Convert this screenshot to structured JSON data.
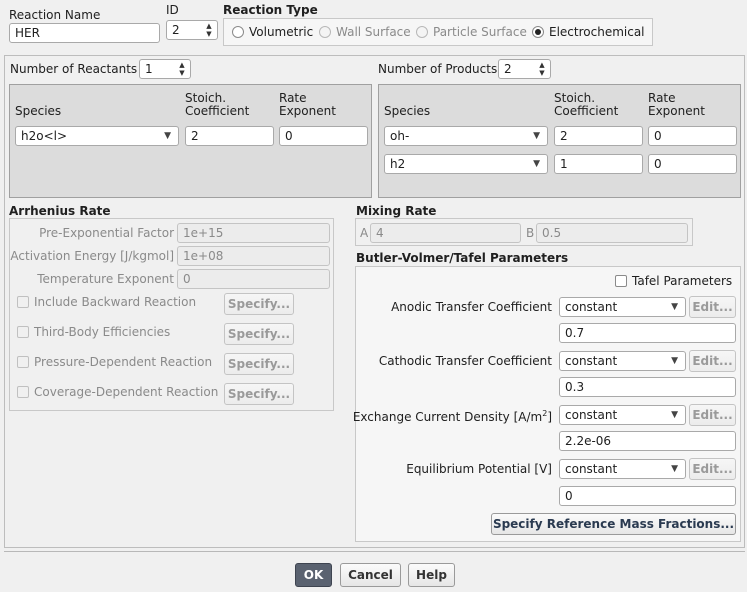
{
  "reaction_name": {
    "label": "Reaction Name",
    "value": "HER"
  },
  "id": {
    "label": "ID",
    "value": "2"
  },
  "reaction_type": {
    "label": "Reaction Type",
    "options": [
      {
        "label": "Volumetric",
        "selected": false,
        "enabled": true
      },
      {
        "label": "Wall Surface",
        "selected": false,
        "enabled": false
      },
      {
        "label": "Particle Surface",
        "selected": false,
        "enabled": false
      },
      {
        "label": "Electrochemical",
        "selected": true,
        "enabled": true
      }
    ]
  },
  "reactants": {
    "count_label": "Number of Reactants",
    "count": "1",
    "col_species": "Species",
    "col_stoich": "Stoich.",
    "col_stoich2": "Coefficient",
    "col_rate": "Rate",
    "col_rate2": "Exponent",
    "rows": [
      {
        "species": "h2o<l>",
        "stoich": "2",
        "rate": "0"
      }
    ]
  },
  "products": {
    "count_label": "Number of Products",
    "count": "2",
    "col_species": "Species",
    "col_stoich": "Stoich.",
    "col_stoich2": "Coefficient",
    "col_rate": "Rate",
    "col_rate2": "Exponent",
    "rows": [
      {
        "species": "oh-",
        "stoich": "2",
        "rate": "0"
      },
      {
        "species": "h2",
        "stoich": "1",
        "rate": "0"
      }
    ]
  },
  "arrhenius": {
    "title": "Arrhenius Rate",
    "pre_exp_label": "Pre-Exponential Factor",
    "pre_exp_value": "1e+15",
    "activation_label": "Activation Energy [J/kgmol]",
    "activation_value": "1e+08",
    "temp_exp_label": "Temperature Exponent",
    "temp_exp_value": "0",
    "options": [
      {
        "label": "Include Backward Reaction",
        "button": "Specify..."
      },
      {
        "label": "Third-Body Efficiencies",
        "button": "Specify..."
      },
      {
        "label": "Pressure-Dependent Reaction",
        "button": "Specify..."
      },
      {
        "label": "Coverage-Dependent Reaction",
        "button": "Specify..."
      }
    ]
  },
  "mixing": {
    "title": "Mixing Rate",
    "a_label": "A",
    "a_value": "4",
    "b_label": "B",
    "b_value": "0.5"
  },
  "butler": {
    "title": "Butler-Volmer/Tafel Parameters",
    "tafel_label": "Tafel Parameters",
    "rows": [
      {
        "label": "Anodic Transfer Coefficient",
        "method": "constant",
        "edit": "Edit...",
        "value": "0.7"
      },
      {
        "label": "Cathodic Transfer Coefficient",
        "method": "constant",
        "edit": "Edit...",
        "value": "0.3"
      },
      {
        "label": "Exchange Current Density [A/m",
        "label_sup": "2",
        "label_end": "]",
        "method": "constant",
        "edit": "Edit...",
        "value": "2.2e-06"
      },
      {
        "label": "Equilibrium Potential [V]",
        "method": "constant",
        "edit": "Edit...",
        "value": "0"
      }
    ],
    "ref_button": "Specify Reference Mass Fractions..."
  },
  "footer": {
    "ok": "OK",
    "cancel": "Cancel",
    "help": "Help"
  },
  "colors": {
    "ok_button": "#5a6270",
    "panel_gray": "#dcdcdc"
  }
}
